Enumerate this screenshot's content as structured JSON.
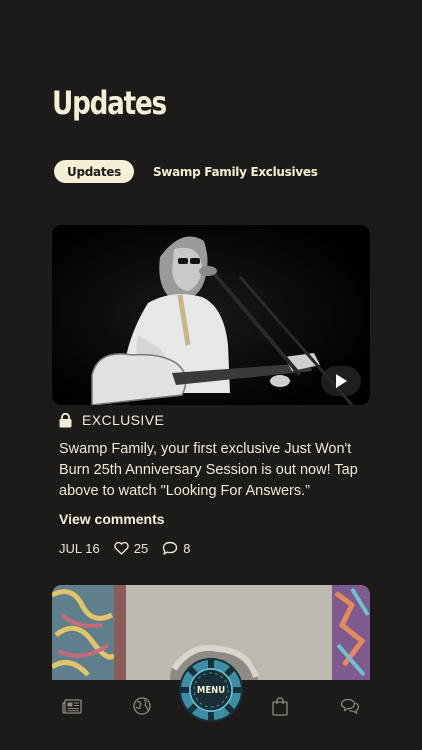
{
  "header": {
    "title": "Updates"
  },
  "tabs": [
    {
      "label": "Updates",
      "active": true
    },
    {
      "label": "Swamp Family Exclusives",
      "active": false
    }
  ],
  "post": {
    "badge": "EXCLUSIVE",
    "text": "Swamp Family, your first exclusive Just Won't Burn 25th Anniversary Session is out now! Tap above to watch \"Looking For Answers.”",
    "view_comments": "View comments",
    "date": "JUL 16",
    "likes": "25",
    "comments": "8"
  },
  "nav": {
    "items": [
      "news-icon",
      "globe-icon",
      "menu-button",
      "bag-icon",
      "chat-icon"
    ],
    "menu_label": "MENU"
  },
  "colors": {
    "background": "#1c1b1a",
    "cream": "#f6efd8",
    "menu_accent": "#4aa8c0"
  }
}
